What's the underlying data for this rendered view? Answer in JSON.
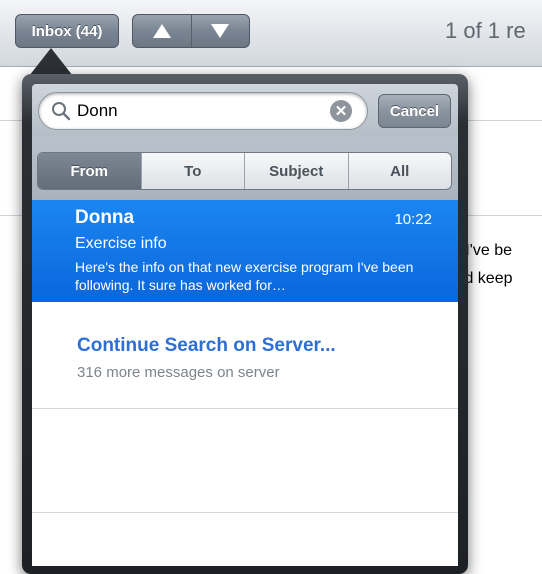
{
  "toolbar": {
    "inbox_label": "Inbox (44)",
    "prev_icon": "up-triangle-icon",
    "next_icon": "down-triangle-icon",
    "message_position": "1 of 1 re"
  },
  "background_message": {
    "line1": "n I've be",
    "line2": "uld keep"
  },
  "search": {
    "value": "Donn",
    "search_icon": "magnifier-icon",
    "clear_icon": "clear-x-icon",
    "cancel_label": "Cancel"
  },
  "scope": {
    "options": [
      "From",
      "To",
      "Subject",
      "All"
    ],
    "selected": "From"
  },
  "results": [
    {
      "sender": "Donna",
      "time": "10:22",
      "subject": "Exercise info",
      "preview": "Here's the info on that new exercise program I've been following. It sure has worked for…",
      "selected": true
    }
  ],
  "continue_search": {
    "title": "Continue Search on Server...",
    "subtitle": "316 more messages on server"
  },
  "colors": {
    "selection_blue": "#1b86f0",
    "link_blue": "#2e6fd4"
  }
}
